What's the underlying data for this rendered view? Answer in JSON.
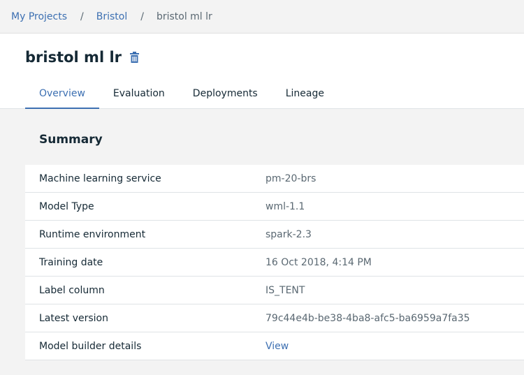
{
  "breadcrumb": {
    "items": [
      {
        "label": "My Projects"
      },
      {
        "label": "Bristol"
      }
    ],
    "separator": "/",
    "current": "bristol ml lr"
  },
  "header": {
    "title": "bristol ml lr",
    "delete_icon": "trash-icon"
  },
  "tabs": [
    {
      "label": "Overview",
      "active": true
    },
    {
      "label": "Evaluation",
      "active": false
    },
    {
      "label": "Deployments",
      "active": false
    },
    {
      "label": "Lineage",
      "active": false
    }
  ],
  "summary": {
    "title": "Summary",
    "rows": [
      {
        "label": "Machine learning service",
        "value": "pm-20-brs"
      },
      {
        "label": "Model Type",
        "value": "wml-1.1"
      },
      {
        "label": "Runtime environment",
        "value": "spark-2.3"
      },
      {
        "label": "Training date",
        "value": "16 Oct 2018, 4:14 PM"
      },
      {
        "label": "Label column",
        "value": "IS_TENT"
      },
      {
        "label": "Latest version",
        "value": "79c44e4b-be38-4ba8-afc5-ba6959a7fa35"
      },
      {
        "label": "Model builder details",
        "value": "View"
      }
    ]
  },
  "colors": {
    "accent": "#3d70b2",
    "text": "#152935",
    "muted": "#5a6872",
    "background": "#f3f3f3"
  }
}
